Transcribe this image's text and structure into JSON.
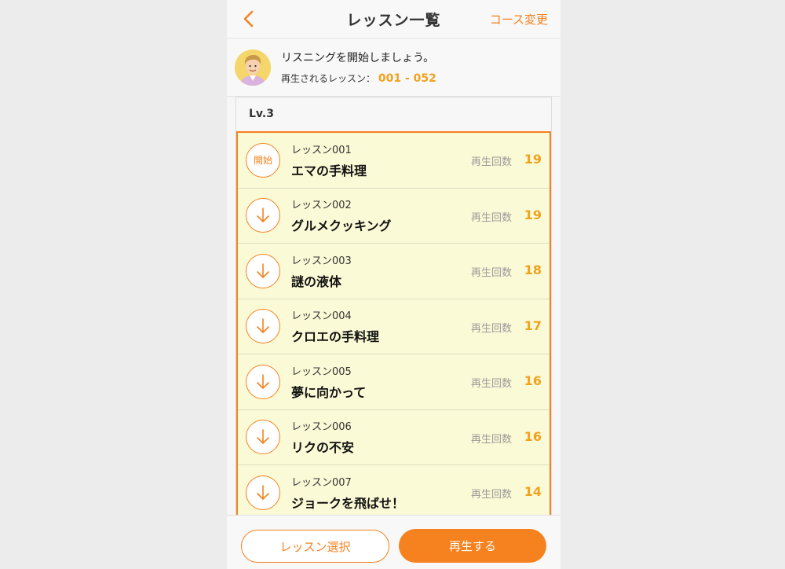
{
  "nav": {
    "title": "レッスン一覧",
    "action": "コース変更",
    "back_icon": "chevron-left-icon"
  },
  "info": {
    "message": "リスニングを開始しましょう。",
    "range_label": "再生されるレッスン：",
    "range_value": "001 - 052"
  },
  "level": {
    "label": "Lv.3"
  },
  "lessons": [
    {
      "number": "レッスン001",
      "name": "エマの手料理",
      "count_label": "再生回数",
      "count": "19",
      "button": "開始",
      "icon": "start-label"
    },
    {
      "number": "レッスン002",
      "name": "グルメクッキング",
      "count_label": "再生回数",
      "count": "19",
      "icon": "download-arrow-icon"
    },
    {
      "number": "レッスン003",
      "name": "謎の液体",
      "count_label": "再生回数",
      "count": "18",
      "icon": "download-arrow-icon"
    },
    {
      "number": "レッスン004",
      "name": "クロエの手料理",
      "count_label": "再生回数",
      "count": "17",
      "icon": "download-arrow-icon"
    },
    {
      "number": "レッスン005",
      "name": "夢に向かって",
      "count_label": "再生回数",
      "count": "16",
      "icon": "download-arrow-icon"
    },
    {
      "number": "レッスン006",
      "name": "リクの不安",
      "count_label": "再生回数",
      "count": "16",
      "icon": "download-arrow-icon"
    },
    {
      "number": "レッスン007",
      "name": "ジョークを飛ばせ！",
      "count_label": "再生回数",
      "count": "14",
      "icon": "download-arrow-icon"
    }
  ],
  "footer": {
    "select_label": "レッスン選択",
    "play_label": "再生する"
  },
  "colors": {
    "accent": "#f5821f",
    "count": "#f0a21f",
    "row_bg": "#fbfad6"
  }
}
